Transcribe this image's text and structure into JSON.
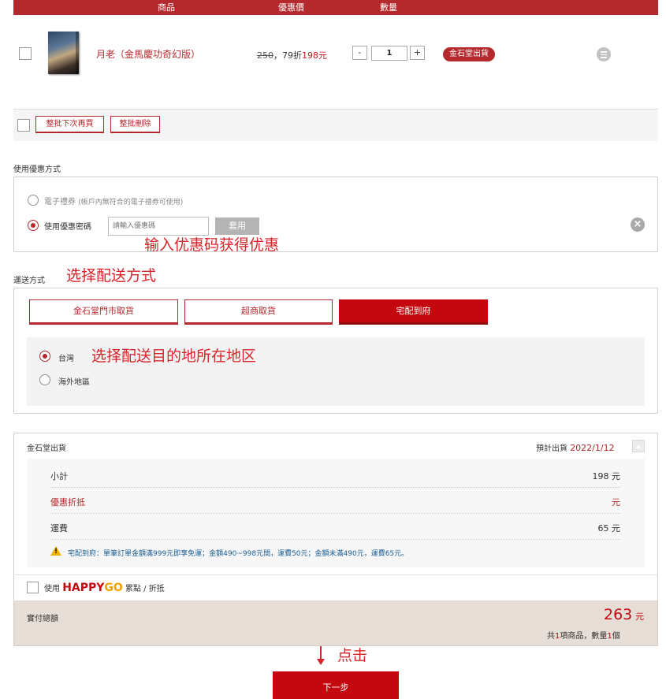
{
  "table_header": {
    "product": "商品",
    "price": "優惠價",
    "quantity": "數量"
  },
  "product": {
    "name": "月老（金馬慶功奇幻版）",
    "original_price": "250",
    "discount_text": "，79折",
    "sale_price": "198",
    "currency": "元",
    "quantity": "1",
    "minus_label": "-",
    "plus_label": "+",
    "ship_badge": "金石堂出貨"
  },
  "batch": {
    "later_label": "整批下次再買",
    "delete_label": "整批刪除"
  },
  "coupon": {
    "section_title": "使用優惠方式",
    "egift_label": "電子禮券",
    "egift_hint": "(帳戶內無符合的電子禮券可使用)",
    "code_label": "使用優惠密碼",
    "code_placeholder": "請輸入優惠碼",
    "apply_label": "套用",
    "clear_icon": "×",
    "annotation": "输入优惠码获得优惠"
  },
  "shipping": {
    "section_title": "運送方式",
    "annotation": "选择配送方式",
    "options": [
      "金石堂門市取貨",
      "超商取貨",
      "宅配到府"
    ],
    "selected": "宅配到府",
    "region_taiwan": "台灣",
    "region_overseas": "海外地區",
    "region_annotation": "选择配送目的地所在地区"
  },
  "summary": {
    "title": "金石堂出貨",
    "eta_label": "預計出貨",
    "eta_date": "2022/1/12",
    "subtotal_label": "小計",
    "subtotal_value": "198 元",
    "discount_label": "優惠折抵",
    "discount_value": "元",
    "freight_label": "運費",
    "freight_value": "65 元",
    "freight_note": "宅配到府：單筆訂單金額滿999元即享免運；金額490~998元間，運費50元；金額未滿490元，運費65元。"
  },
  "happygo": {
    "prefix": "使用",
    "brand_happy": "HAPPY",
    "brand_go": "GO",
    "suffix": "累點 / 折抵"
  },
  "total": {
    "label": "實付總額",
    "amount": "263",
    "currency": "元",
    "count_prefix": "共",
    "item_count": "1",
    "count_mid": "項商品，數量",
    "qty_count": "1",
    "count_suffix": "個"
  },
  "next": {
    "label": "下一步",
    "annotation": "点击"
  },
  "colors": {
    "brand_red": "#b3292d",
    "button_red": "#c5080f",
    "annotation_red": "#d9232a"
  }
}
